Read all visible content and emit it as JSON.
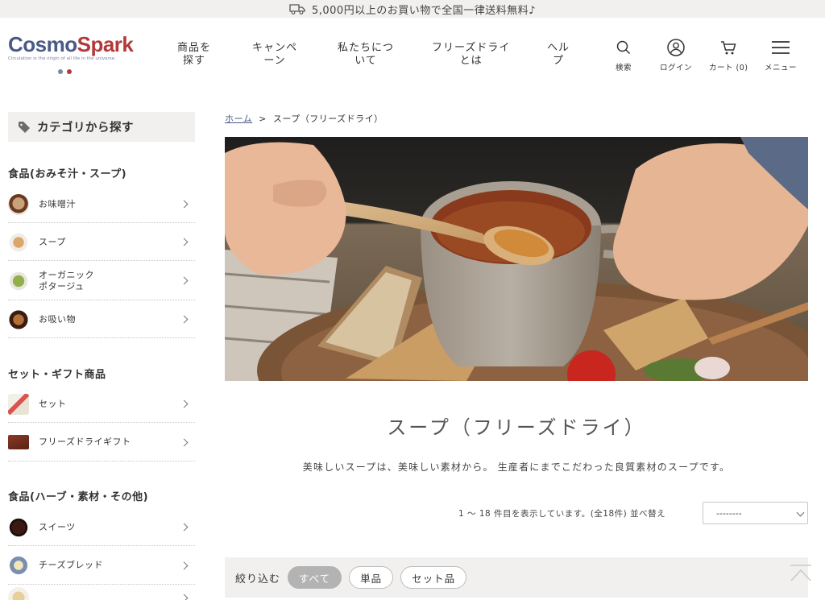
{
  "promo": {
    "text": "5,000円以上のお買い物で全国一律送料無料♪",
    "icon": "truck-icon"
  },
  "logo": {
    "part1": "Cosmo",
    "part2": "Spark",
    "tagline": "Circulation is the origin of all life in the universe.",
    "dot_colors": [
      "#7c86a6",
      "#b23a3a"
    ]
  },
  "nav": [
    {
      "line1": "商品を",
      "line2": "探す"
    },
    {
      "line1": "キャンペ",
      "line2": "ーン"
    },
    {
      "line1": "私たちにつ",
      "line2": "いて"
    },
    {
      "line1": "フリーズドライ",
      "line2": "とは"
    },
    {
      "line1": "ヘル",
      "line2": "プ"
    }
  ],
  "header_icons": {
    "search": "検索",
    "login": "ログイン",
    "cart": "カート (0)",
    "menu": "メニュー"
  },
  "sidebar": {
    "heading": "カテゴリから探す",
    "groups": [
      {
        "title": "食品(おみそ汁・スープ)",
        "items": [
          {
            "line1": "お味噌汁",
            "line2": ""
          },
          {
            "line1": "スープ",
            "line2": ""
          },
          {
            "line1": "オーガニック",
            "line2": "ポタージュ"
          },
          {
            "line1": "お吸い物",
            "line2": ""
          }
        ]
      },
      {
        "title": "セット・ギフト商品",
        "items": [
          {
            "line1": "セット",
            "line2": ""
          },
          {
            "line1": "フリーズドライギフト",
            "line2": ""
          }
        ]
      },
      {
        "title": "食品(ハーブ・素材・その他)",
        "items": [
          {
            "line1": "スイーツ",
            "line2": ""
          },
          {
            "line1": "チーズブレッド",
            "line2": ""
          }
        ]
      }
    ]
  },
  "breadcrumb": {
    "home": "ホーム",
    "separator": ">",
    "current": "スープ（フリーズドライ）"
  },
  "main": {
    "title": "スープ（フリーズドライ）",
    "description": "美味しいスープは、美味しい素材から。 生産者にまでこだわった良質素材のスープです。",
    "count": "1 ～ 18 件目を表示しています。(全18件) 並べ替え",
    "sort_value": "--------"
  },
  "filter": {
    "label": "絞り込む",
    "options": [
      "すべて",
      "単品",
      "セット品"
    ],
    "active": "すべて"
  },
  "colors": {
    "accent": "#4a5a86",
    "brand_red": "#b23a3a",
    "panel_bg": "#f1f0ee"
  }
}
